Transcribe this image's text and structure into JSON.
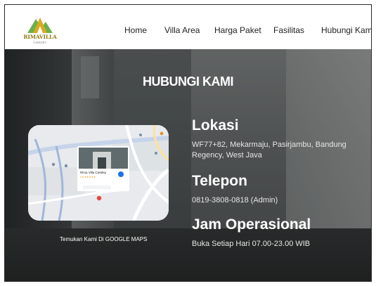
{
  "brand": {
    "name": "RIMAVILLA",
    "sub": "CIWIDEY",
    "colors": {
      "gold": "#8d7a16",
      "green": "#6ab04c"
    }
  },
  "nav": {
    "items": [
      {
        "label": "Home"
      },
      {
        "label": "Villa Area"
      },
      {
        "label": "Harga Paket"
      },
      {
        "label": "Fasilitas"
      },
      {
        "label": "Hubungi Kami"
      }
    ]
  },
  "hero": {
    "title": "HUBUNGI KAMI"
  },
  "map": {
    "place_name": "Rima Villa Ciwidey",
    "rating": "4.6 ★★★★★",
    "caption": "Temukan Kami Di GOOGLE MAPS"
  },
  "contact": {
    "location_heading": "Lokasi",
    "location_text": "WF77+82, Mekarmaju, Pasirjambu, Bandung Regency, West Java",
    "phone_heading": "Telepon",
    "phone_text": "0819-3808-0818 (Admin)",
    "hours_heading": "Jam Operasional",
    "hours_text": "Buka Setiap Hari 07.00-23.00 WIB"
  }
}
